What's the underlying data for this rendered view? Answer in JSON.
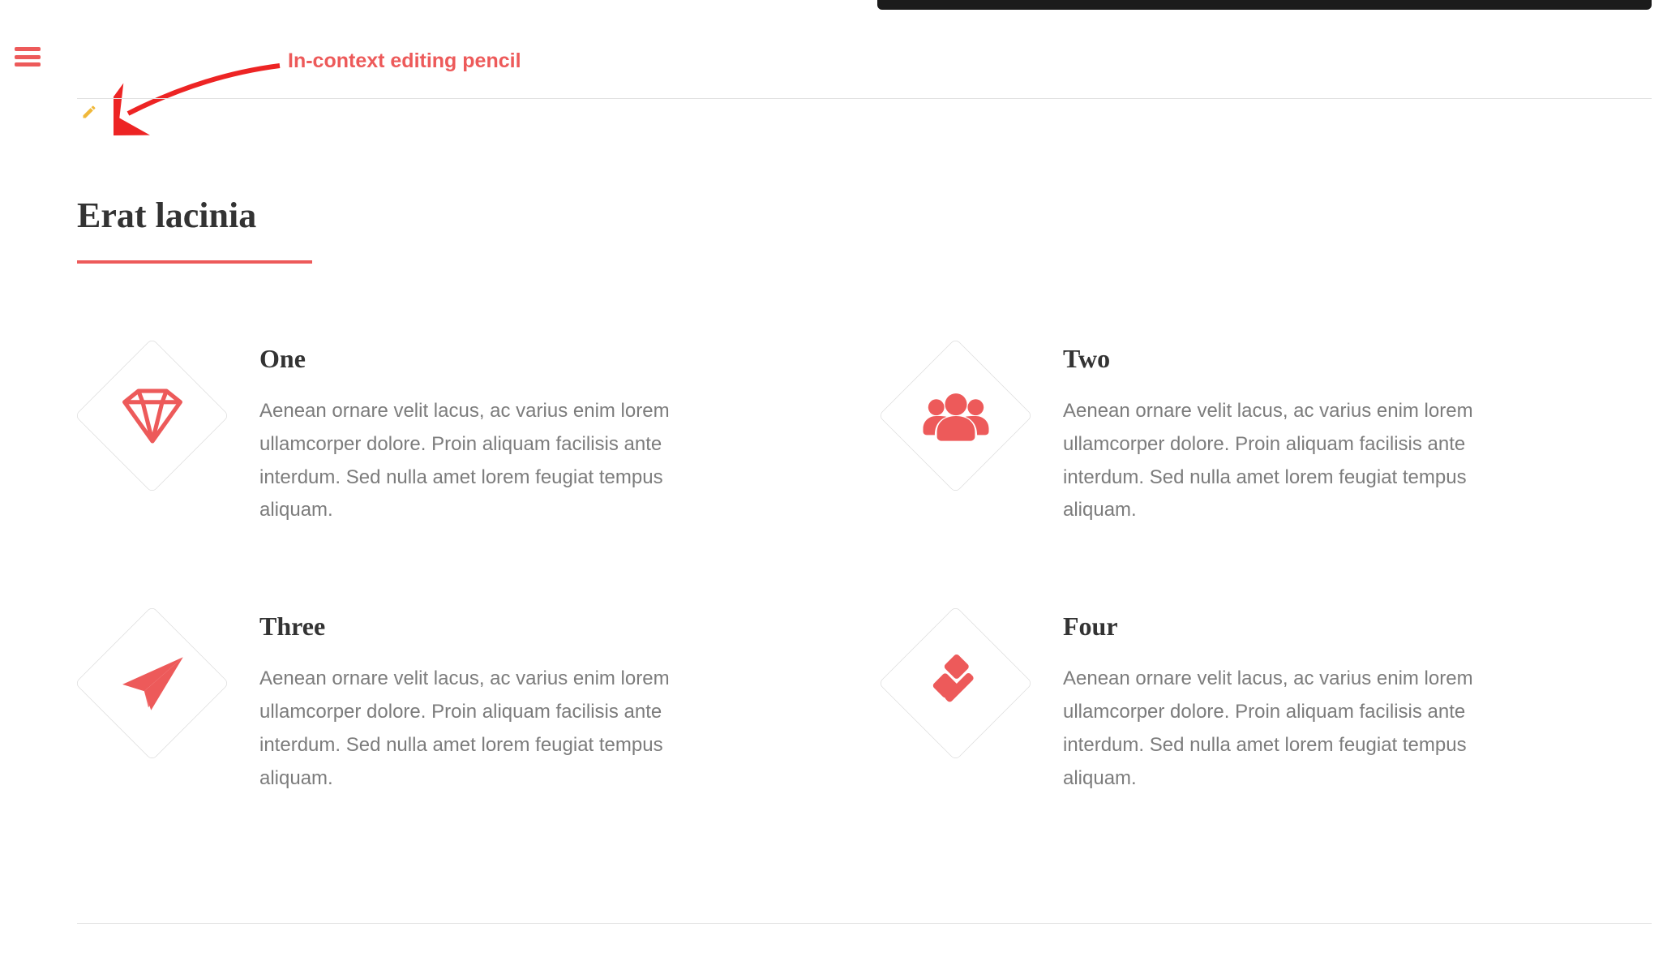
{
  "annotation_label": "In-context editing pencil",
  "section_title": "Erat lacinia",
  "features": [
    {
      "icon": "diamond-gem-icon",
      "title": "One",
      "desc": "Aenean ornare velit lacus, ac varius enim lorem ullamcorper dolore. Proin aliquam facilisis ante interdum. Sed nulla amet lorem feugiat tempus aliquam."
    },
    {
      "icon": "users-icon",
      "title": "Two",
      "desc": "Aenean ornare velit lacus, ac varius enim lorem ullamcorper dolore. Proin aliquam facilisis ante interdum. Sed nulla amet lorem feugiat tempus aliquam."
    },
    {
      "icon": "paper-plane-icon",
      "title": "Three",
      "desc": "Aenean ornare velit lacus, ac varius enim lorem ullamcorper dolore. Proin aliquam facilisis ante interdum. Sed nulla amet lorem feugiat tempus aliquam."
    },
    {
      "icon": "gavel-icon",
      "title": "Four",
      "desc": "Aenean ornare velit lacus, ac varius enim lorem ullamcorper dolore. Proin aliquam facilisis ante interdum. Sed nulla amet lorem feugiat tempus aliquam."
    }
  ],
  "colors": {
    "accent": "#ed5a5a"
  }
}
